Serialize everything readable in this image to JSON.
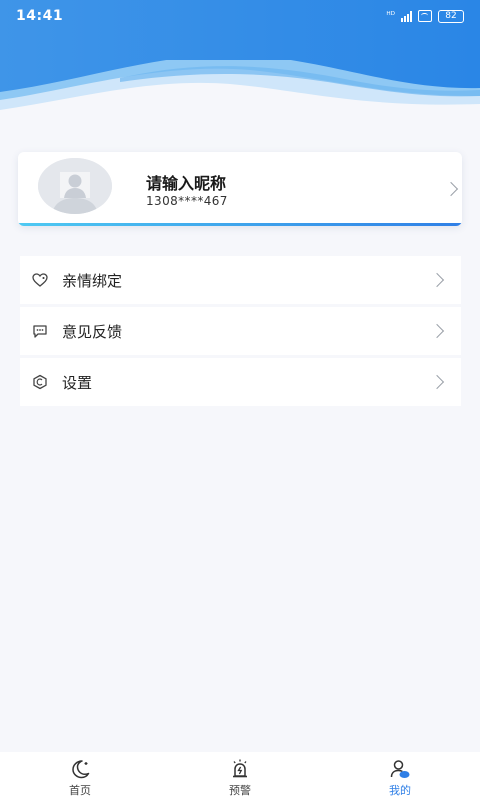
{
  "status_bar": {
    "time": "14:41",
    "signal_text": "Wi-Fi",
    "battery": "82"
  },
  "profile": {
    "nickname_placeholder": "请输入昵称",
    "phone": "1308****467"
  },
  "menu": {
    "items": [
      {
        "label": "亲情绑定",
        "icon": "heart-link-icon"
      },
      {
        "label": "意见反馈",
        "icon": "chat-bubble-icon"
      },
      {
        "label": "设置",
        "icon": "settings-hex-icon"
      }
    ]
  },
  "bottom_nav": {
    "items": [
      {
        "label": "首页",
        "icon": "moon-icon",
        "active": false
      },
      {
        "label": "预警",
        "icon": "alarm-light-icon",
        "active": false
      },
      {
        "label": "我的",
        "icon": "user-icon",
        "active": true
      }
    ]
  },
  "colors": {
    "accent": "#2f7fe6",
    "header_light": "#8ec8f4",
    "background": "#f6f7fb"
  }
}
